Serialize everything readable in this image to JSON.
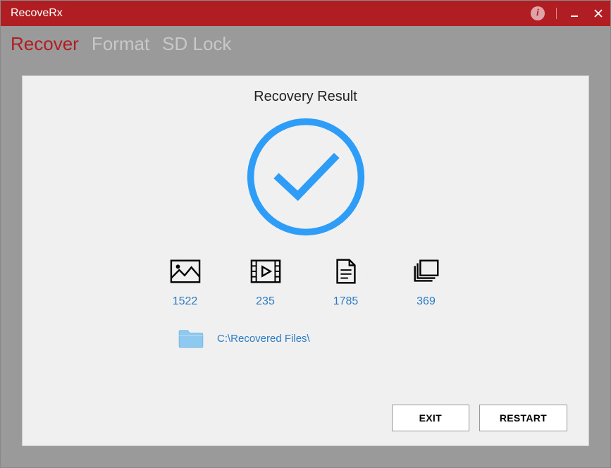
{
  "window": {
    "title": "RecoveRx"
  },
  "tabs": {
    "recover": "Recover",
    "format": "Format",
    "sdlock": "SD Lock"
  },
  "panel": {
    "title": "Recovery Result"
  },
  "stats": {
    "photos": "1522",
    "videos": "235",
    "documents": "1785",
    "other": "369"
  },
  "path": "C:\\Recovered Files\\",
  "buttons": {
    "exit": "EXIT",
    "restart": "RESTART"
  }
}
